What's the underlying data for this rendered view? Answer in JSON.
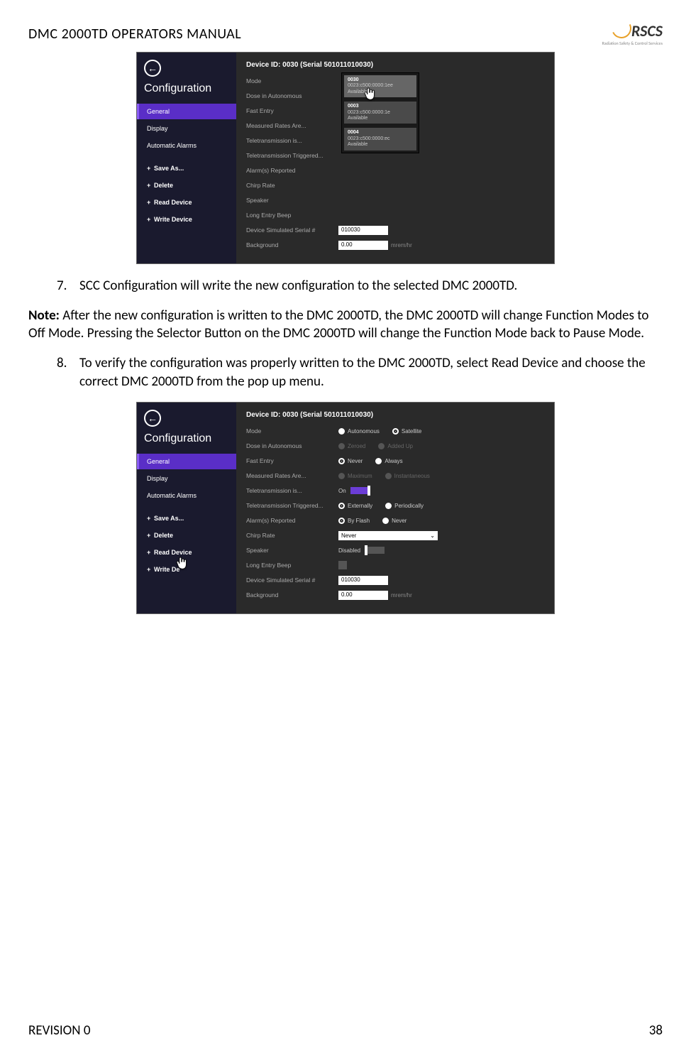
{
  "header": {
    "title": "DMC 2000TD OPERATORS MANUAL",
    "logo_main": "RSCS",
    "logo_sub": "Radiation Safety & Control Services"
  },
  "screenshot1": {
    "config_title": "Configuration",
    "device_header": "Device ID: 0030 (Serial 501011010030)",
    "sidebar": [
      {
        "label": "General",
        "selected": true,
        "bold": false,
        "plus": false
      },
      {
        "label": "Display",
        "selected": false,
        "bold": false,
        "plus": false
      },
      {
        "label": "Automatic Alarms",
        "selected": false,
        "bold": false,
        "plus": false
      },
      {
        "label": "Save As...",
        "selected": false,
        "bold": true,
        "plus": true
      },
      {
        "label": "Delete",
        "selected": false,
        "bold": true,
        "plus": true
      },
      {
        "label": "Read Device",
        "selected": false,
        "bold": true,
        "plus": true
      },
      {
        "label": "Write Device",
        "selected": false,
        "bold": true,
        "plus": true
      }
    ],
    "rows": [
      {
        "label": "Mode"
      },
      {
        "label": "Dose in Autonomous"
      },
      {
        "label": "Fast Entry"
      },
      {
        "label": "Measured Rates Are..."
      },
      {
        "label": "Teletransmission is..."
      },
      {
        "label": "Teletransmission Triggered..."
      },
      {
        "label": "Alarm(s) Reported"
      },
      {
        "label": "Chirp Rate"
      },
      {
        "label": "Speaker"
      },
      {
        "label": "Long Entry Beep"
      }
    ],
    "serial_row": {
      "label": "Device Simulated Serial #",
      "value": "010030"
    },
    "bg_row": {
      "label": "Background",
      "value": "0.00",
      "unit": "mrem/hr"
    },
    "popup": [
      {
        "id": "0030",
        "mac": "0023:c500:0000:1ee",
        "status": "Available",
        "sel": true
      },
      {
        "id": "0003",
        "mac": "0023:c500:0000:1e",
        "status": "Available",
        "sel": false
      },
      {
        "id": "0004",
        "mac": "0023:c500:0000:ec",
        "status": "Available",
        "sel": false
      }
    ]
  },
  "step7": {
    "num": "7.",
    "text": "SCC Configuration will write the new configuration to the selected DMC 2000TD."
  },
  "note": {
    "label": "Note:",
    "text": " After the new configuration is written to the DMC 2000TD, the DMC 2000TD will change Function Modes to Off Mode. Pressing the Selector Button on the DMC 2000TD will change the Function Mode back to Pause Mode."
  },
  "step8": {
    "num": "8.",
    "text": "To verify the configuration was properly written to the DMC 2000TD, select Read Device and choose the correct DMC 2000TD from the pop up menu."
  },
  "screenshot2": {
    "config_title": "Configuration",
    "device_header": "Device ID: 0030 (Serial 501011010030)",
    "sidebar": [
      {
        "label": "General",
        "selected": true,
        "bold": false,
        "plus": false
      },
      {
        "label": "Display",
        "selected": false,
        "bold": false,
        "plus": false
      },
      {
        "label": "Automatic Alarms",
        "selected": false,
        "bold": false,
        "plus": false
      },
      {
        "label": "Save As...",
        "selected": false,
        "bold": true,
        "plus": true
      },
      {
        "label": "Delete",
        "selected": false,
        "bold": true,
        "plus": true
      },
      {
        "label": "Read Device",
        "selected": false,
        "bold": true,
        "plus": true
      },
      {
        "label": "Write De",
        "selected": false,
        "bold": true,
        "plus": true
      }
    ],
    "rows": {
      "mode": {
        "label": "Mode",
        "opt1": "Autonomous",
        "opt2": "Satellite"
      },
      "dose": {
        "label": "Dose in Autonomous",
        "opt1": "Zeroed",
        "opt2": "Added Up"
      },
      "fast": {
        "label": "Fast Entry",
        "opt1": "Never",
        "opt2": "Always"
      },
      "rates": {
        "label": "Measured Rates Are...",
        "opt1": "Maximum",
        "opt2": "Instantaneous"
      },
      "tele": {
        "label": "Teletransmission is...",
        "state": "On"
      },
      "teletrig": {
        "label": "Teletransmission Triggered...",
        "opt1": "Externally",
        "opt2": "Periodically"
      },
      "alarm": {
        "label": "Alarm(s) Reported",
        "opt1": "By Flash",
        "opt2": "Never"
      },
      "chirp": {
        "label": "Chirp Rate",
        "value": "Never"
      },
      "speaker": {
        "label": "Speaker",
        "state": "Disabled"
      },
      "beep": {
        "label": "Long Entry Beep"
      },
      "serial": {
        "label": "Device Simulated Serial #",
        "value": "010030"
      },
      "bg": {
        "label": "Background",
        "value": "0.00",
        "unit": "mrem/hr"
      }
    }
  },
  "footer": {
    "revision": "REVISION 0",
    "page": "38"
  }
}
